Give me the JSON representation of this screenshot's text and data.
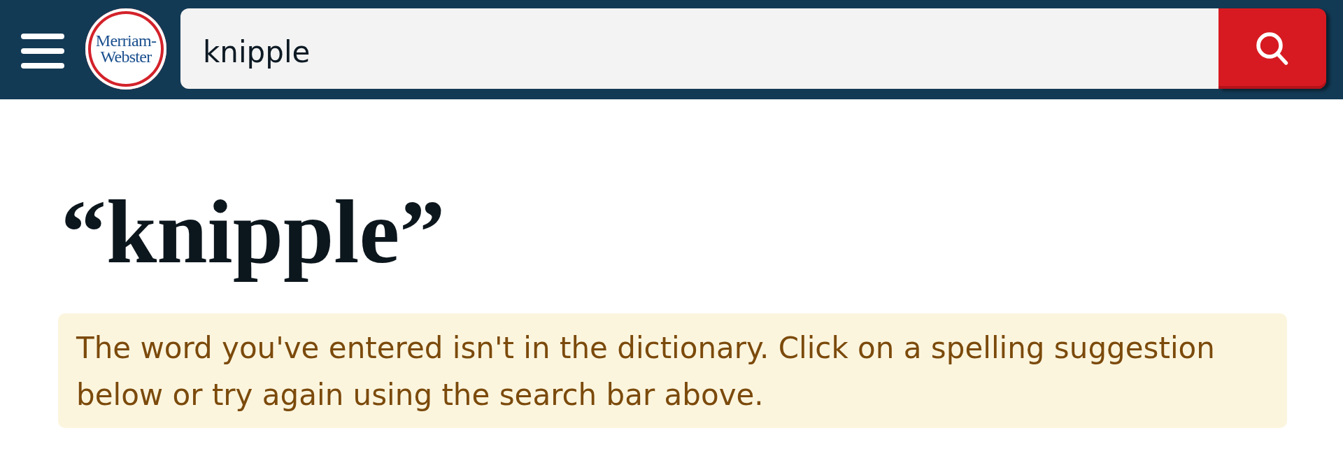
{
  "header": {
    "logo_lines": [
      "Merriam-",
      "Webster"
    ],
    "search": {
      "value": "knipple"
    }
  },
  "heading": {
    "text": "“knipple”"
  },
  "notice": {
    "text": "The word you've entered isn't in the dictionary. Click on a spelling suggestion below or try again using the search bar above."
  }
}
